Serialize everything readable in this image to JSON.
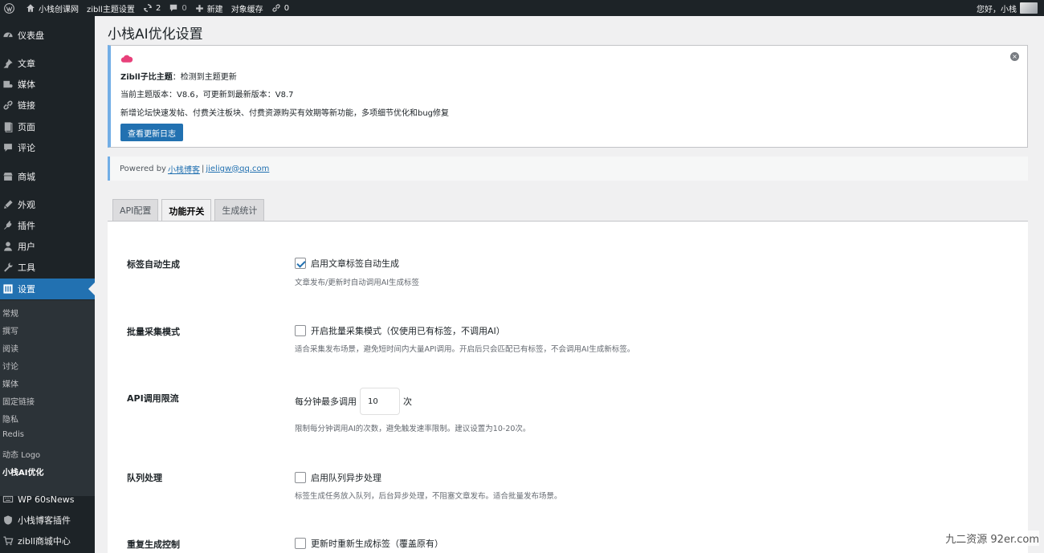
{
  "adminbar": {
    "site_name": "小栈创课网",
    "theme_settings": "zibll主题设置",
    "updates_count": "2",
    "comments_count": "0",
    "new_label": "新建",
    "object_cache": "对象缓存",
    "links_count": "0",
    "greeting": "您好，小栈"
  },
  "sidebar": {
    "items": [
      {
        "label": "仪表盘",
        "icon": "dashboard-icon"
      },
      {
        "label": "文章",
        "icon": "pin-icon"
      },
      {
        "label": "媒体",
        "icon": "media-icon"
      },
      {
        "label": "链接",
        "icon": "link-icon"
      },
      {
        "label": "页面",
        "icon": "page-icon"
      },
      {
        "label": "评论",
        "icon": "comment-icon"
      },
      {
        "label": "商城",
        "icon": "store-icon"
      },
      {
        "label": "外观",
        "icon": "appearance-icon"
      },
      {
        "label": "插件",
        "icon": "plugin-icon"
      },
      {
        "label": "用户",
        "icon": "user-icon"
      },
      {
        "label": "工具",
        "icon": "wrench-icon"
      },
      {
        "label": "设置",
        "icon": "settings-icon"
      }
    ],
    "submenu": [
      "常规",
      "撰写",
      "阅读",
      "讨论",
      "媒体",
      "固定链接",
      "隐私",
      "Redis",
      "动态 Logo",
      "小栈AI优化"
    ],
    "bottom_items": [
      {
        "label": "WP 60sNews",
        "icon": "keyboard-icon"
      },
      {
        "label": "小栈博客插件",
        "icon": "shield-icon"
      },
      {
        "label": "zibll商城中心",
        "icon": "cart-icon"
      }
    ]
  },
  "page": {
    "title": "小栈AI优化设置"
  },
  "notice": {
    "title_bold": "Zibll子比主题",
    "title_rest": "：检测到主题更新",
    "version_line": "当前主题版本：V8.6，可更新到最新版本：V8.7",
    "desc_line": "新增论坛快速发帖、付费关注板块、付费资源购买有效期等新功能，多项细节优化和bug修复",
    "button": "查看更新日志",
    "dismiss": "×"
  },
  "powered": {
    "prefix": "Powered by",
    "link1": "小栈博客",
    "separator": "|",
    "link2": "jieligw@qq.com"
  },
  "tabs": [
    {
      "label": "API配置",
      "active": false
    },
    {
      "label": "功能开关",
      "active": true
    },
    {
      "label": "生成统计",
      "active": false
    }
  ],
  "settings": {
    "tag_auto": {
      "label": "标签自动生成",
      "checkbox_label": "启用文章标签自动生成",
      "checked": true,
      "desc": "文章发布/更新时自动调用AI生成标签"
    },
    "batch_mode": {
      "label": "批量采集模式",
      "checkbox_label": "开启批量采集模式（仅使用已有标签，不调用AI）",
      "checked": false,
      "desc": "适合采集发布场景，避免短时间内大量API调用。开启后只会匹配已有标签，不会调用AI生成新标签。"
    },
    "rate_limit": {
      "label": "API调用限流",
      "prefix": "每分钟最多调用",
      "value": "10",
      "suffix": "次",
      "desc": "限制每分钟调用AI的次数，避免触发速率限制。建议设置为10-20次。"
    },
    "queue": {
      "label": "队列处理",
      "checkbox_label": "启用队列异步处理",
      "checked": false,
      "desc": "标签生成任务放入队列，后台异步处理，不阻塞文章发布。适合批量发布场景。"
    },
    "regen": {
      "label": "重复生成控制",
      "checkbox_label": "更新时重新生成标签（覆盖原有）",
      "checked": false
    }
  },
  "watermark": "九二资源  92er.com"
}
